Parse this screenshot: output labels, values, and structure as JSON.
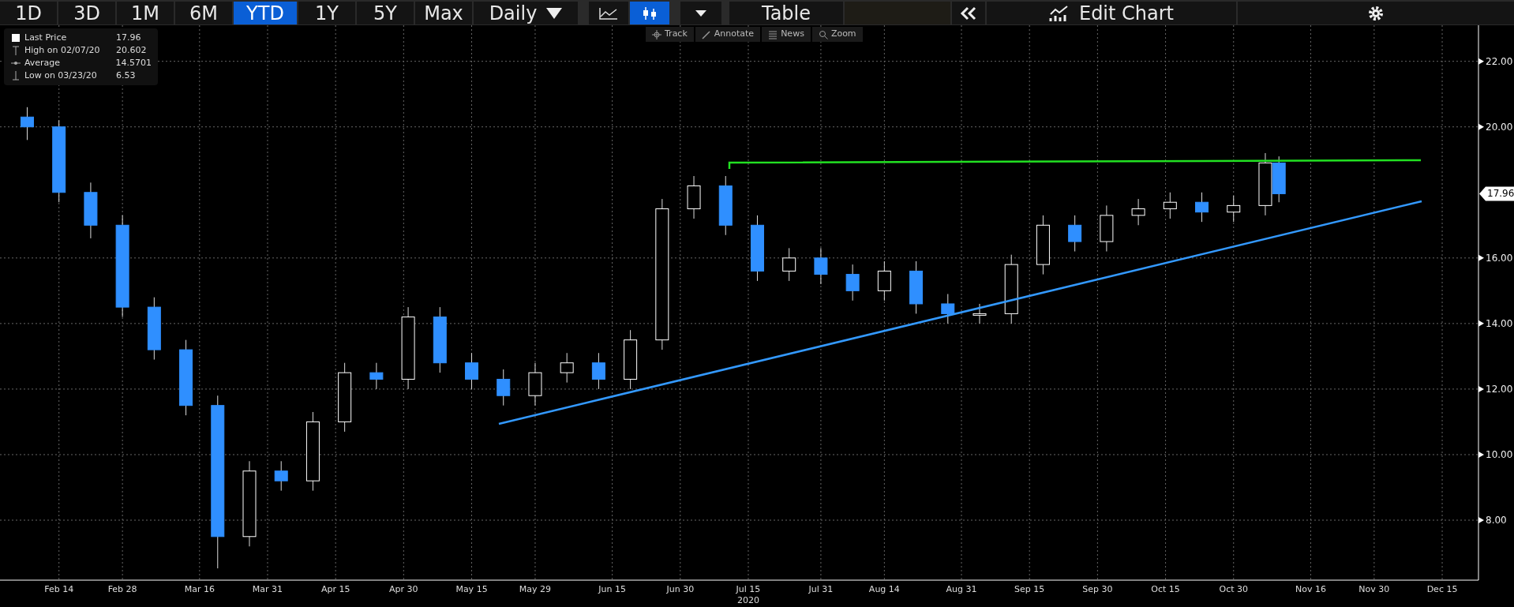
{
  "toolbar": {
    "ranges": [
      {
        "label": "1D",
        "selected": false
      },
      {
        "label": "3D",
        "selected": false
      },
      {
        "label": "1M",
        "selected": false
      },
      {
        "label": "6M",
        "selected": false
      },
      {
        "label": "YTD",
        "selected": true
      },
      {
        "label": "1Y",
        "selected": false
      },
      {
        "label": "5Y",
        "selected": false
      },
      {
        "label": "Max",
        "selected": false
      }
    ],
    "interval": "Daily",
    "chart_styles": [
      {
        "kind": "line",
        "selected": false
      },
      {
        "kind": "candle",
        "selected": true
      }
    ],
    "table_button": "Table",
    "edit_chart_button": "Edit Chart"
  },
  "chart_tools": [
    {
      "kind": "track",
      "label": "Track"
    },
    {
      "kind": "annotate",
      "label": "Annotate"
    },
    {
      "kind": "news",
      "label": "News"
    },
    {
      "kind": "zoom",
      "label": "Zoom"
    }
  ],
  "legend": [
    {
      "kind": "last",
      "label": "Last Price",
      "value": "17.96"
    },
    {
      "kind": "high",
      "label": "High on 02/07/20",
      "value": "20.602"
    },
    {
      "kind": "average",
      "label": "Average",
      "value": "14.5701"
    },
    {
      "kind": "low",
      "label": "Low on 03/23/20",
      "value": "6.53"
    }
  ],
  "last_price_tag": "17.96",
  "year_label": "2020",
  "trend_lines": [
    {
      "color": "#22e022"
    },
    {
      "color": "#3399ff"
    }
  ],
  "chart_data": {
    "type": "candlestick",
    "grid": true,
    "x": [
      "2020-02-07",
      "2020-02-14",
      "2020-02-21",
      "2020-02-28",
      "2020-03-06",
      "2020-03-13",
      "2020-03-20",
      "2020-03-27",
      "2020-04-03",
      "2020-04-10",
      "2020-04-17",
      "2020-04-24",
      "2020-05-01",
      "2020-05-08",
      "2020-05-15",
      "2020-05-22",
      "2020-05-29",
      "2020-06-05",
      "2020-06-12",
      "2020-06-19",
      "2020-06-26",
      "2020-07-03",
      "2020-07-10",
      "2020-07-17",
      "2020-07-24",
      "2020-07-31",
      "2020-08-07",
      "2020-08-14",
      "2020-08-21",
      "2020-08-28",
      "2020-09-04",
      "2020-09-11",
      "2020-09-18",
      "2020-09-25",
      "2020-10-02",
      "2020-10-09",
      "2020-10-16",
      "2020-10-23",
      "2020-10-30",
      "2020-11-06",
      "2020-11-09"
    ],
    "ohlc": [
      [
        20.3,
        20.6,
        19.6,
        20.0
      ],
      [
        20.0,
        20.2,
        17.7,
        18.0
      ],
      [
        18.0,
        18.3,
        16.6,
        17.0
      ],
      [
        17.0,
        17.3,
        14.2,
        14.5
      ],
      [
        14.5,
        14.8,
        12.9,
        13.2
      ],
      [
        13.2,
        13.5,
        11.2,
        11.5
      ],
      [
        11.5,
        11.8,
        6.53,
        7.5
      ],
      [
        7.5,
        9.8,
        7.2,
        9.5
      ],
      [
        9.5,
        9.8,
        8.9,
        9.2
      ],
      [
        9.2,
        11.3,
        8.9,
        11.0
      ],
      [
        11.0,
        12.8,
        10.7,
        12.5
      ],
      [
        12.5,
        12.8,
        12.0,
        12.3
      ],
      [
        12.3,
        14.5,
        12.0,
        14.2
      ],
      [
        14.2,
        14.5,
        12.5,
        12.8
      ],
      [
        12.8,
        13.1,
        12.0,
        12.3
      ],
      [
        12.3,
        12.6,
        11.5,
        11.8
      ],
      [
        11.8,
        12.8,
        11.5,
        12.5
      ],
      [
        12.5,
        13.1,
        12.2,
        12.8
      ],
      [
        12.8,
        13.1,
        12.0,
        12.3
      ],
      [
        12.3,
        13.8,
        12.0,
        13.5
      ],
      [
        13.5,
        17.8,
        13.2,
        17.5
      ],
      [
        17.5,
        18.5,
        17.2,
        18.2
      ],
      [
        18.2,
        18.5,
        16.7,
        17.0
      ],
      [
        17.0,
        17.3,
        15.3,
        15.6
      ],
      [
        15.6,
        16.3,
        15.3,
        16.0
      ],
      [
        16.0,
        16.3,
        15.2,
        15.5
      ],
      [
        15.5,
        15.8,
        14.7,
        15.0
      ],
      [
        15.0,
        15.9,
        14.7,
        15.6
      ],
      [
        15.6,
        15.9,
        14.3,
        14.6
      ],
      [
        14.6,
        14.9,
        14.0,
        14.3
      ],
      [
        14.3,
        14.6,
        14.0,
        14.3
      ],
      [
        14.3,
        16.1,
        14.0,
        15.8
      ],
      [
        15.8,
        17.3,
        15.5,
        17.0
      ],
      [
        17.0,
        17.3,
        16.2,
        16.5
      ],
      [
        16.5,
        17.6,
        16.2,
        17.3
      ],
      [
        17.3,
        17.8,
        17.0,
        17.5
      ],
      [
        17.5,
        18.0,
        17.2,
        17.7
      ],
      [
        17.7,
        18.0,
        17.1,
        17.4
      ],
      [
        17.4,
        17.9,
        17.1,
        17.6
      ],
      [
        17.6,
        19.2,
        17.3,
        18.9
      ],
      [
        18.9,
        19.1,
        17.7,
        17.96
      ]
    ],
    "xlim": [
      "2020-02-01",
      "2020-12-23"
    ],
    "ylim": [
      6.17,
      23.1
    ],
    "xticks": [
      {
        "value": "2020-02-14",
        "label": "Feb 14"
      },
      {
        "value": "2020-02-28",
        "label": "Feb 28"
      },
      {
        "value": "2020-03-16",
        "label": "Mar 16"
      },
      {
        "value": "2020-03-31",
        "label": "Mar 31"
      },
      {
        "value": "2020-04-15",
        "label": "Apr 15"
      },
      {
        "value": "2020-04-30",
        "label": "Apr 30"
      },
      {
        "value": "2020-05-15",
        "label": "May 15"
      },
      {
        "value": "2020-05-29",
        "label": "May 29"
      },
      {
        "value": "2020-06-15",
        "label": "Jun 15"
      },
      {
        "value": "2020-06-30",
        "label": "Jun 30"
      },
      {
        "value": "2020-07-15",
        "label": "Jul 15"
      },
      {
        "value": "2020-07-31",
        "label": "Jul 31"
      },
      {
        "value": "2020-08-14",
        "label": "Aug 14"
      },
      {
        "value": "2020-08-31",
        "label": "Aug 31"
      },
      {
        "value": "2020-09-15",
        "label": "Sep 15"
      },
      {
        "value": "2020-09-30",
        "label": "Sep 30"
      },
      {
        "value": "2020-10-15",
        "label": "Oct 15"
      },
      {
        "value": "2020-10-30",
        "label": "Oct 30"
      },
      {
        "value": "2020-11-16",
        "label": "Nov 16"
      },
      {
        "value": "2020-11-30",
        "label": "Nov 30"
      },
      {
        "value": "2020-12-15",
        "label": "Dec 15"
      }
    ],
    "yticks": [
      {
        "value": 8,
        "label": "8.00"
      },
      {
        "value": 10,
        "label": "10.00"
      },
      {
        "value": 12,
        "label": "12.00"
      },
      {
        "value": 14,
        "label": "14.00"
      },
      {
        "value": 16,
        "label": "16.00"
      },
      {
        "value": 20,
        "label": "20.00"
      },
      {
        "value": 22,
        "label": "22.00"
      }
    ]
  }
}
